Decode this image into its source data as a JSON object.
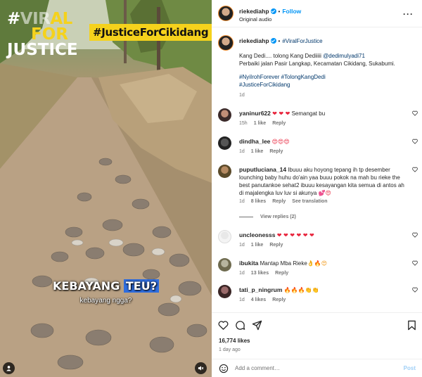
{
  "media": {
    "brand_line1_a": "#",
    "brand_line1_b": "VIR",
    "brand_line1_c": "AL",
    "brand_line2": "FOR",
    "brand_line3": "JUSTICE",
    "tagline": "#JusticeForCikidang",
    "subtitle_main_a": "KEBAYANG ",
    "subtitle_main_b": "TEU?",
    "subtitle_translation": "kebayang ngga?"
  },
  "header": {
    "username": "riekediahp",
    "follow_label": "Follow",
    "audio_label": "Original audio"
  },
  "caption": {
    "username": "riekediahp",
    "hashtag_top": "#ViralForJustice",
    "text_1": "Kang Dedi.... tolong Kang Dediiiii ",
    "mention": "@dedimulyadi71",
    "text_2": "Perbaiki jalan Pasir Langkap, Kecamatan Cikidang, Sukabumi.",
    "hashtags_1": "#NyiIrohForever #TolongKangDedi",
    "hashtags_2": "#JusticeForCikidang",
    "time": "1d"
  },
  "comments": [
    {
      "user": "yaninur622",
      "text": "Semangat bu",
      "emoji": "❤ ❤ ❤",
      "time": "15h",
      "likes": "1 like",
      "reply": "Reply"
    },
    {
      "user": "dindha_lee",
      "text": "",
      "emoji": "😍😍😍",
      "time": "1d",
      "likes": "1 like",
      "reply": "Reply"
    },
    {
      "user": "puputluciana_14",
      "text": "Ibuuu aku hoyong tepang ih tp desember lounching baby huhu do'ain yaa buuu pokok na mah bu rieke the best panutankoe sehat2 ibuuu kesayangan kita semua di antos ah di majalengka luv luv si akunya",
      "emoji": "💕😍",
      "time": "1d",
      "likes": "8 likes",
      "reply": "Reply",
      "translate": "See translation"
    },
    {
      "user": "uncleonesss",
      "text": "",
      "emoji": "❤ ❤ ❤ ❤ ❤ ❤",
      "time": "1d",
      "likes": "1 like",
      "reply": "Reply"
    },
    {
      "user": "ibukita",
      "text": "Mantap Mba Rieke",
      "emoji": "👌🔥😍",
      "time": "1d",
      "likes": "13 likes",
      "reply": "Reply"
    },
    {
      "user": "tati_p_ningrum",
      "text": "",
      "emoji": "🔥🔥🔥👏👏",
      "time": "1d",
      "likes": "4 likes",
      "reply": "Reply"
    }
  ],
  "view_replies": "View replies (2)",
  "stats": {
    "likes": "16,774 likes",
    "ago": "1 day ago"
  },
  "add_comment": {
    "placeholder": "Add a comment…",
    "post_label": "Post"
  },
  "icons": {
    "heart": "heart-icon",
    "comment": "comment-icon",
    "share": "share-icon",
    "save": "bookmark-icon",
    "more": "more-options-icon",
    "emoji": "emoji-icon",
    "mute": "volume-muted-icon",
    "tags": "user-tag-icon"
  },
  "colors": {
    "link": "#00376b",
    "accent": "#0095f6",
    "brand_yellow": "#f5d21c",
    "subtitle_highlight": "#2f6ee0"
  }
}
